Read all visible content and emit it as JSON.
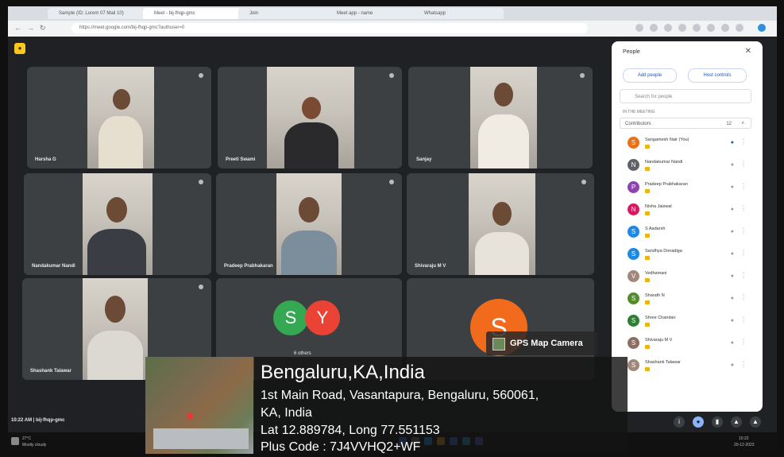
{
  "browser": {
    "tabs": [
      {
        "label": "Sample (ID: Lorem 07 Mail 10)"
      },
      {
        "label": "Meet - bij-fhqp-gmc"
      },
      {
        "label": "Join"
      },
      {
        "label": "Meet app - name"
      },
      {
        "label": "Whatsapp"
      }
    ],
    "url": "https://meet.google.com/bij-fhqp-gmc?authuser=0"
  },
  "meet": {
    "participants": [
      {
        "name": "Harsha G"
      },
      {
        "name": "Preeti Swami"
      },
      {
        "name": "Sanjay"
      },
      {
        "name": "Nandakumar Nandi"
      },
      {
        "name": "Pradeep Prabhakaran"
      },
      {
        "name": "Shivaraju M V"
      },
      {
        "name": "Shashank Talawar"
      }
    ],
    "others_tile": {
      "initials": [
        "S",
        "Y"
      ],
      "label": "6 others"
    },
    "s_tile": {
      "initial": "S"
    },
    "time_code": "10:22 AM  |  bij-fhqp-gmc"
  },
  "people_panel": {
    "title": "People",
    "add_people": "Add people",
    "host_controls": "Host controls",
    "search_placeholder": "Search for people",
    "section_label": "IN THE MEETING",
    "contributors_label": "Contributors",
    "contributors_count": "12",
    "people": [
      {
        "name": "Sangamesh Nair (You)",
        "initial": "S",
        "color": "#e8711a"
      },
      {
        "name": "Nandakumar Nandi",
        "initial": "N",
        "color": "#5f6368"
      },
      {
        "name": "Pradeep Prabhakaran",
        "initial": "P",
        "color": "#8e44ad"
      },
      {
        "name": "Nisha Jaiswal",
        "initial": "N",
        "color": "#d81b60"
      },
      {
        "name": "S Aadarsh",
        "initial": "S",
        "color": "#1e88e5"
      },
      {
        "name": "Sandhya Donadiga",
        "initial": "S",
        "color": "#1e88e5"
      },
      {
        "name": "Vedhamani",
        "initial": "V",
        "color": "#a1887f"
      },
      {
        "name": "Sharath N",
        "initial": "S",
        "color": "#558b2f"
      },
      {
        "name": "Shree Chandan",
        "initial": "S",
        "color": "#2e7d32"
      },
      {
        "name": "Shivaraju M V",
        "initial": "S",
        "color": "#8d6e63"
      },
      {
        "name": "Shashank Talawar",
        "initial": "S",
        "color": "#a1887f"
      }
    ]
  },
  "taskbar": {
    "weather": "27°C",
    "weather_sub": "Mostly cloudy",
    "clock_time": "10:22",
    "clock_date": "20-12-2023"
  },
  "gps_overlay": {
    "badge": "GPS Map Camera",
    "city": "Bengaluru,KA,India",
    "address_line1": "1st Main Road, Vasantapura, Bengaluru, 560061,",
    "address_line2": "KA, India",
    "coords": "Lat 12.889784, Long 77.551153",
    "plus_code": "Plus Code : 7J4VVHQ2+WF"
  }
}
